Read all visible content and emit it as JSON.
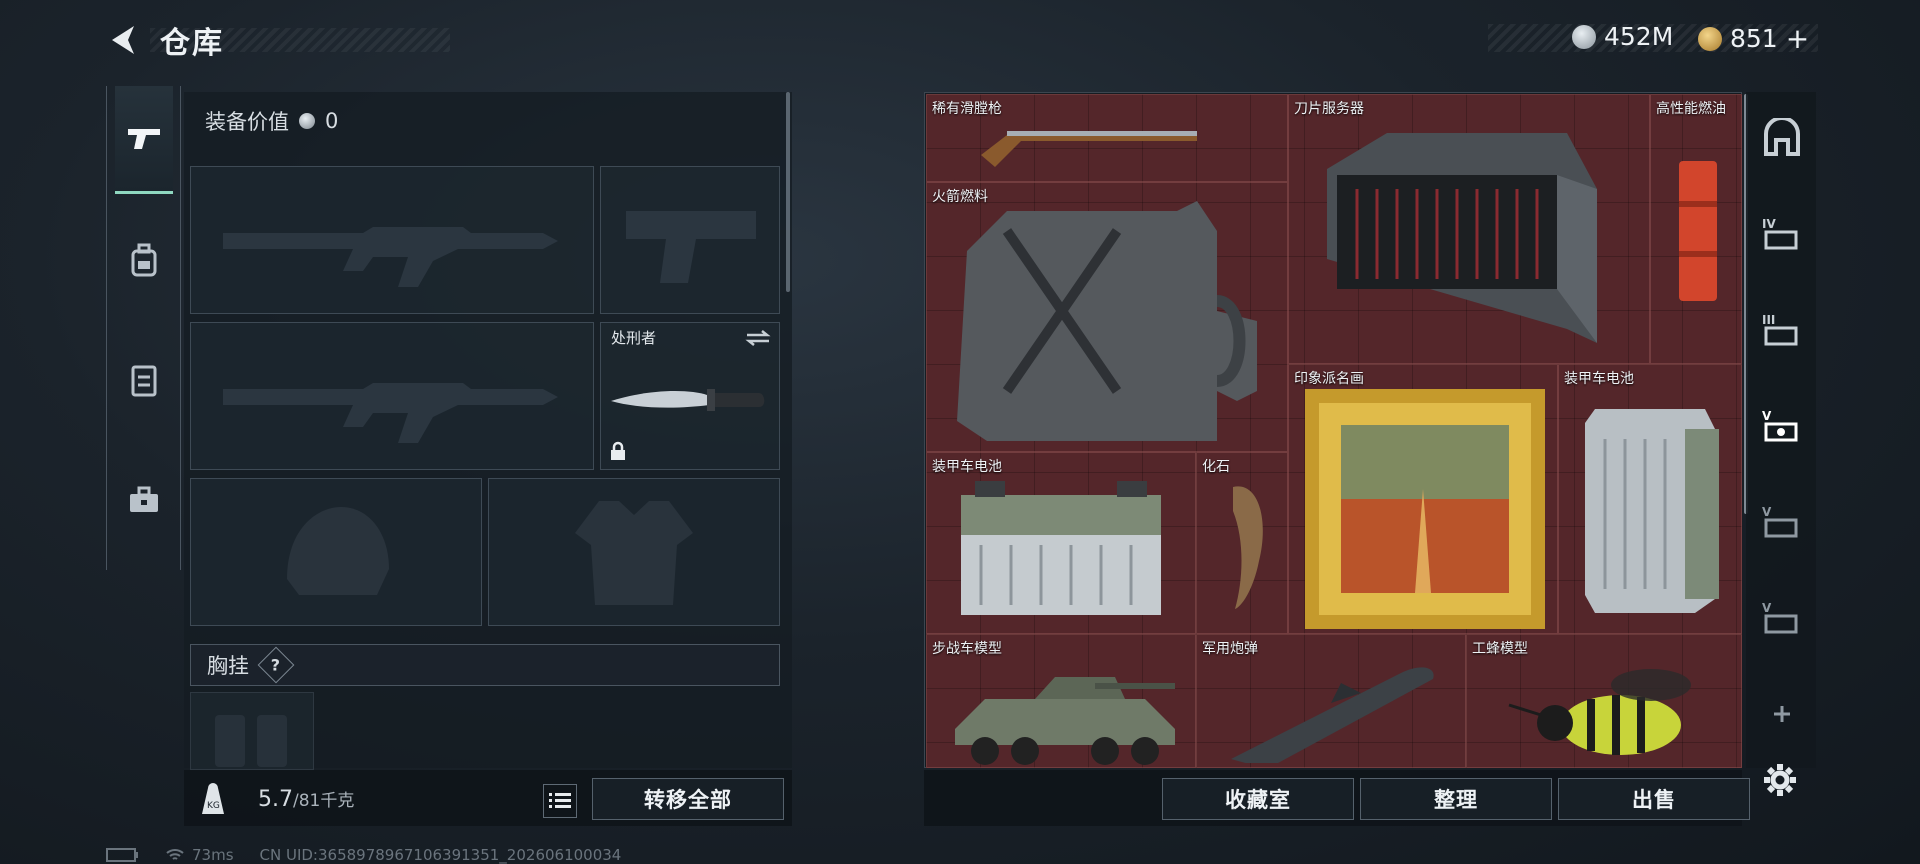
{
  "header": {
    "title": "仓库"
  },
  "currency": {
    "silver": "452M",
    "gold": "851",
    "plus": "+"
  },
  "left_tabs": [
    {
      "name": "pistol-icon"
    },
    {
      "name": "backpack-icon"
    },
    {
      "name": "vest-icon"
    },
    {
      "name": "toolbox-icon"
    }
  ],
  "loadout": {
    "equip_value_label": "装备价值",
    "equip_value": "0",
    "melee_label": "处刑者",
    "chest_label": "胸挂",
    "help": "?",
    "weight_current": "5.7",
    "weight_max": "/81千克",
    "transfer_all": "转移全部"
  },
  "storage": {
    "items": [
      {
        "name": "稀有滑膛枪"
      },
      {
        "name": "刀片服务器"
      },
      {
        "name": "高性能燃油"
      },
      {
        "name": "火箭燃料"
      },
      {
        "name": "印象派名画"
      },
      {
        "name": "装甲车电池"
      },
      {
        "name": "装甲车电池"
      },
      {
        "name": "化石"
      },
      {
        "name": "步战车模型"
      },
      {
        "name": "军用炮弹"
      },
      {
        "name": "工蜂模型"
      }
    ],
    "buttons": {
      "vault": "收藏室",
      "sort": "整理",
      "sell": "出售"
    }
  },
  "status": {
    "ping": "73ms",
    "uid": "CN UID:3658978967106391351_202606100034"
  },
  "colors": {
    "accent": "#8fd8c0",
    "grid_bg": "#54262a",
    "panel": "#141c23"
  }
}
